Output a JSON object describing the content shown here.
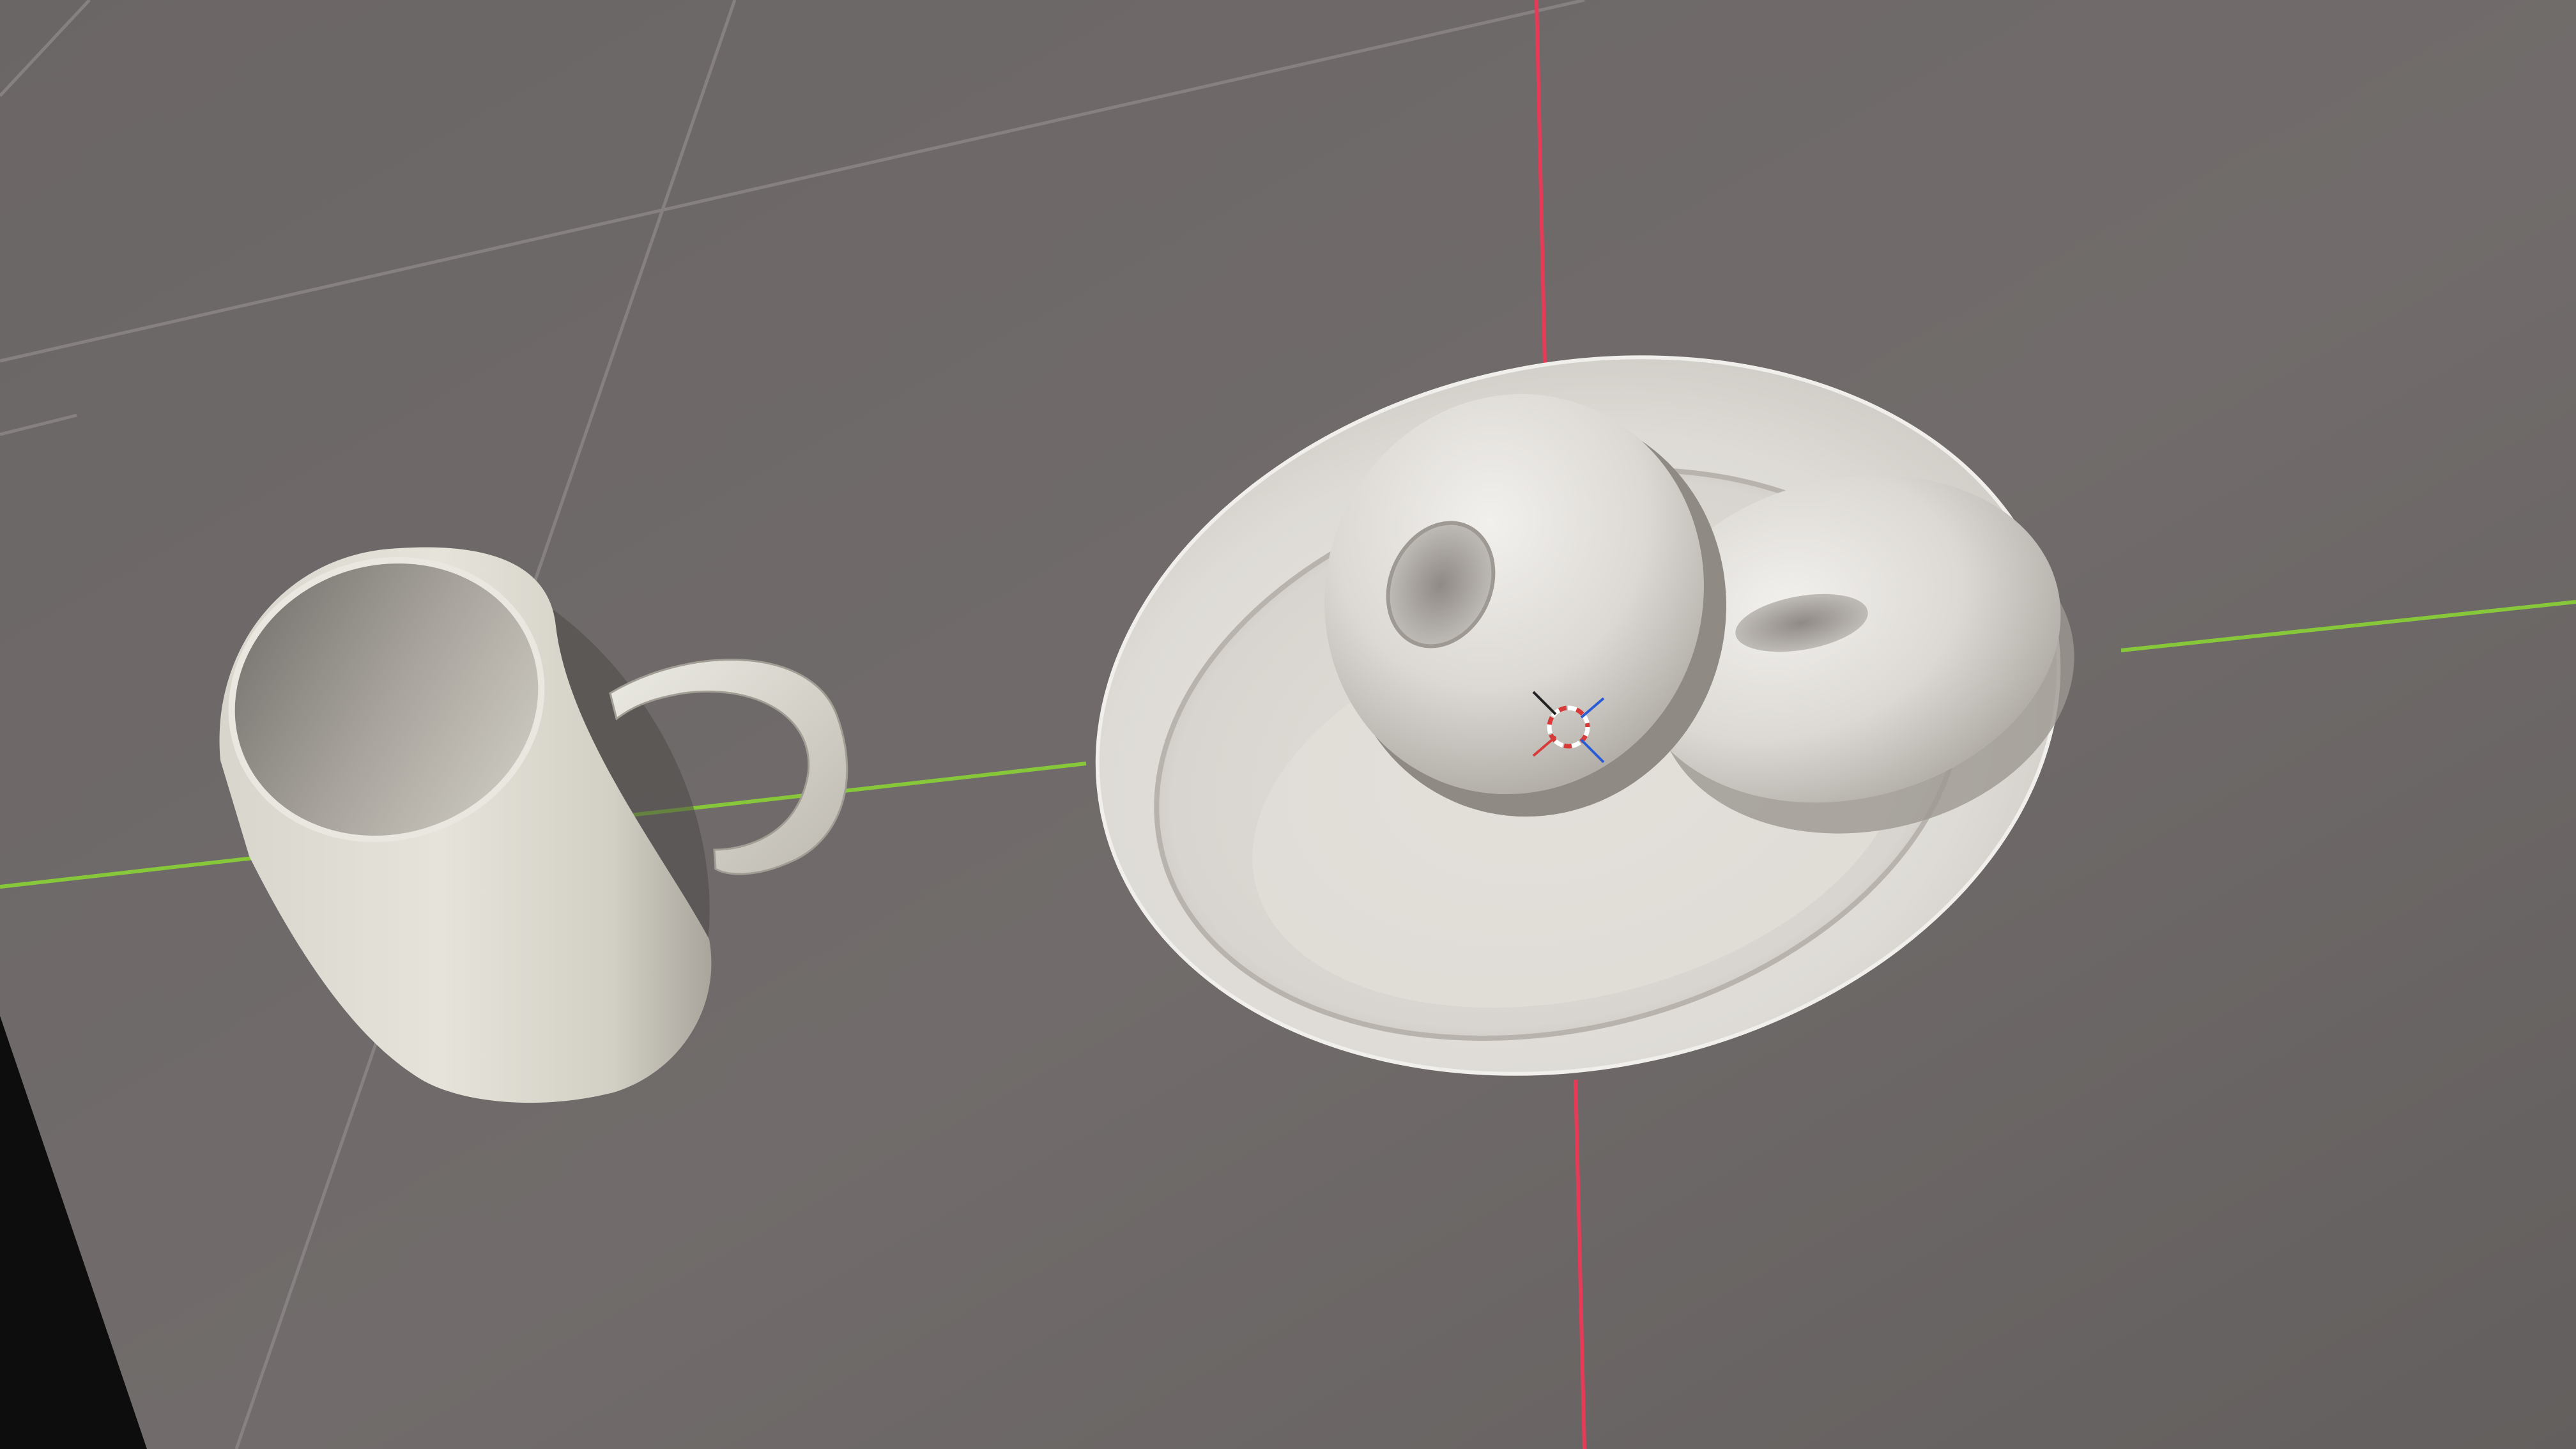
{
  "app": {
    "name": "3D Viewport"
  },
  "viewport": {
    "mode": "solid-shading",
    "background_color": "#6f6b6b",
    "grid_color": "#8a8585",
    "axis_x_color": "#e63a57",
    "axis_y_color": "#86c83a",
    "object_material_color": "#e6e3de"
  },
  "scene": {
    "objects": [
      {
        "name": "mug",
        "icon": "mug-icon"
      },
      {
        "name": "plate",
        "icon": "plate-icon"
      },
      {
        "name": "donut-front",
        "icon": "donut-icon"
      },
      {
        "name": "donut-back",
        "icon": "donut-icon"
      }
    ],
    "origin_gizmo": "3d-cursor-icon"
  }
}
